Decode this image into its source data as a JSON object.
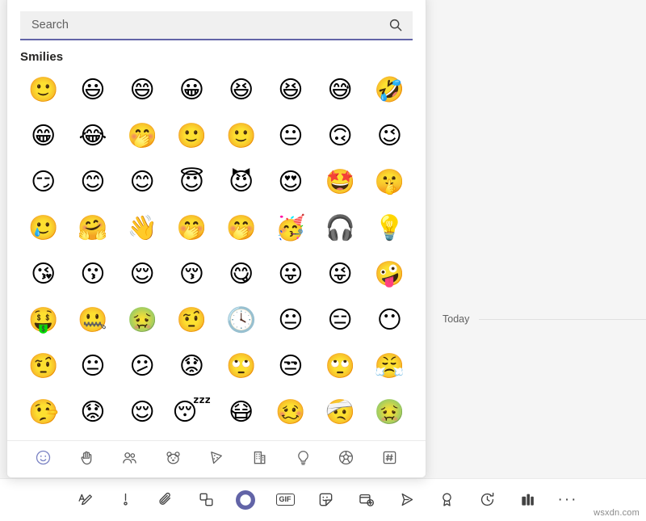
{
  "search": {
    "placeholder": "Search",
    "value": "",
    "icon": "search-icon"
  },
  "category_heading": "Smilies",
  "emoji_grid": {
    "columns": 8,
    "rows": [
      [
        {
          "char": "🙂",
          "name": "slightly-smiling-face"
        },
        {
          "char": "😃",
          "name": "grinning-face-big-eyes"
        },
        {
          "char": "😄",
          "name": "grinning-face-smiling-eyes"
        },
        {
          "char": "😀",
          "name": "grinning-face"
        },
        {
          "char": "😆",
          "name": "grinning-squinting-face"
        },
        {
          "char": "😆",
          "name": "laughing-squinting-face"
        },
        {
          "char": "😅",
          "name": "grinning-face-sweat"
        },
        {
          "char": "🤣",
          "name": "rolling-on-the-floor-laughing"
        }
      ],
      [
        {
          "char": "😁",
          "name": "beaming-face-smiling-eyes"
        },
        {
          "char": "😂",
          "name": "face-with-tears-of-joy"
        },
        {
          "char": "🤭",
          "name": "face-with-hand-over-mouth"
        },
        {
          "char": "🙂",
          "name": "smiling-face-small"
        },
        {
          "char": "🙂",
          "name": "slight-smile"
        },
        {
          "char": "😐",
          "name": "neutral-smile"
        },
        {
          "char": "🙃",
          "name": "upside-down-face"
        },
        {
          "char": "😉",
          "name": "winking-face"
        }
      ],
      [
        {
          "char": "😏",
          "name": "smirking-face"
        },
        {
          "char": "😊",
          "name": "smiling-face-blush"
        },
        {
          "char": "😊",
          "name": "smiling-face-smiling-eyes"
        },
        {
          "char": "😇",
          "name": "smiling-face-with-halo"
        },
        {
          "char": "😈",
          "name": "smiling-face-with-horns"
        },
        {
          "char": "😍",
          "name": "smiling-face-with-heart-eyes"
        },
        {
          "char": "🤩",
          "name": "star-struck"
        },
        {
          "char": "🤫",
          "name": "shushing-face"
        }
      ],
      [
        {
          "char": "🥲",
          "name": "face-holding-back-tears"
        },
        {
          "char": "🤗",
          "name": "hugging-face"
        },
        {
          "char": "👋",
          "name": "waving-face"
        },
        {
          "char": "🤭",
          "name": "hand-over-mouth-giggle"
        },
        {
          "char": "🤭",
          "name": "giggling-face"
        },
        {
          "char": "🥳",
          "name": "partying-face"
        },
        {
          "char": "🎧",
          "name": "face-with-headphones"
        },
        {
          "char": "💡",
          "name": "face-with-lightbulb-idea"
        }
      ],
      [
        {
          "char": "😘",
          "name": "face-blowing-a-kiss"
        },
        {
          "char": "😗",
          "name": "kissing-face"
        },
        {
          "char": "😌",
          "name": "relieved-smiling-face"
        },
        {
          "char": "😚",
          "name": "kissing-face-closed-eyes"
        },
        {
          "char": "😋",
          "name": "face-savoring-food"
        },
        {
          "char": "😛",
          "name": "face-with-tongue"
        },
        {
          "char": "😜",
          "name": "winking-face-with-tongue"
        },
        {
          "char": "🤪",
          "name": "zany-face"
        }
      ],
      [
        {
          "char": "🤑",
          "name": "money-mouth-face"
        },
        {
          "char": "🤐",
          "name": "zipper-mouth-face"
        },
        {
          "char": "🤢",
          "name": "nauseated-angry-green-face"
        },
        {
          "char": "🤨",
          "name": "face-with-raised-eyebrow"
        },
        {
          "char": "🕓",
          "name": "face-with-clock"
        },
        {
          "char": "😐",
          "name": "neutral-face"
        },
        {
          "char": "😑",
          "name": "expressionless-face"
        },
        {
          "char": "😶",
          "name": "face-without-mouth"
        }
      ],
      [
        {
          "char": "🤨",
          "name": "skeptical-face"
        },
        {
          "char": "😐",
          "name": "plain-face"
        },
        {
          "char": "😕",
          "name": "confused-face"
        },
        {
          "char": "😟",
          "name": "worried-face"
        },
        {
          "char": "🙄",
          "name": "face-with-hair-covering-eyes"
        },
        {
          "char": "😒",
          "name": "unamused-face"
        },
        {
          "char": "🙄",
          "name": "face-with-rolling-eyes"
        },
        {
          "char": "😤",
          "name": "face-with-symbols-on-mouth"
        }
      ],
      [
        {
          "char": "🤥",
          "name": "lying-face"
        },
        {
          "char": "😟",
          "name": "sad-worried-face"
        },
        {
          "char": "😌",
          "name": "relieved-face"
        },
        {
          "char": "😴",
          "name": "sleeping-face"
        },
        {
          "char": "😷",
          "name": "face-with-medical-mask"
        },
        {
          "char": "🥴",
          "name": "woozy-face"
        },
        {
          "char": "🤕",
          "name": "face-with-head-bandage"
        },
        {
          "char": "🤢",
          "name": "nauseated-face"
        }
      ]
    ]
  },
  "category_tabs": [
    {
      "name": "tab-smilies",
      "icon": "smiley-icon",
      "active": true
    },
    {
      "name": "tab-hand-gestures",
      "icon": "hand-icon",
      "active": false
    },
    {
      "name": "tab-people",
      "icon": "people-icon",
      "active": false
    },
    {
      "name": "tab-animals",
      "icon": "bear-icon",
      "active": false
    },
    {
      "name": "tab-food",
      "icon": "pizza-icon",
      "active": false
    },
    {
      "name": "tab-travel-places",
      "icon": "building-icon",
      "active": false
    },
    {
      "name": "tab-objects",
      "icon": "lightbulb-icon",
      "active": false
    },
    {
      "name": "tab-activities",
      "icon": "soccer-ball-icon",
      "active": false
    },
    {
      "name": "tab-symbols",
      "icon": "hash-icon",
      "active": false
    }
  ],
  "compose_toolbar": [
    {
      "name": "format-button",
      "icon": "format-text-icon",
      "label": ""
    },
    {
      "name": "importance-button",
      "icon": "exclamation-icon",
      "label": ""
    },
    {
      "name": "attach-button",
      "icon": "paperclip-icon",
      "label": ""
    },
    {
      "name": "loop-component-button",
      "icon": "loop-icon",
      "label": ""
    },
    {
      "name": "emoji-button",
      "icon": "emoji-icon",
      "label": "",
      "active": true
    },
    {
      "name": "giphy-button",
      "icon": "gif-icon",
      "label": "GIF"
    },
    {
      "name": "sticker-button",
      "icon": "sticker-icon",
      "label": ""
    },
    {
      "name": "schedule-meeting-button",
      "icon": "meeting-add-icon",
      "label": ""
    },
    {
      "name": "stream-video-button",
      "icon": "send-stream-icon",
      "label": ""
    },
    {
      "name": "praise-button",
      "icon": "praise-badge-icon",
      "label": ""
    },
    {
      "name": "schedule-send-button",
      "icon": "clock-arrow-icon",
      "label": ""
    },
    {
      "name": "apps-button",
      "icon": "apps-icon",
      "label": ""
    },
    {
      "name": "more-options-button",
      "icon": "ellipsis-icon",
      "label": "···"
    }
  ],
  "chat": {
    "date_divider": "Today"
  },
  "watermark": "wsxdn.com",
  "colors": {
    "accent_purple": "#6264a7",
    "tab_active": "#7b83c4",
    "panel_bg": "#ffffff",
    "surface_bg": "#f5f5f5",
    "search_bg": "#f0f0f0",
    "text_primary": "#252423",
    "text_secondary": "#616161"
  }
}
